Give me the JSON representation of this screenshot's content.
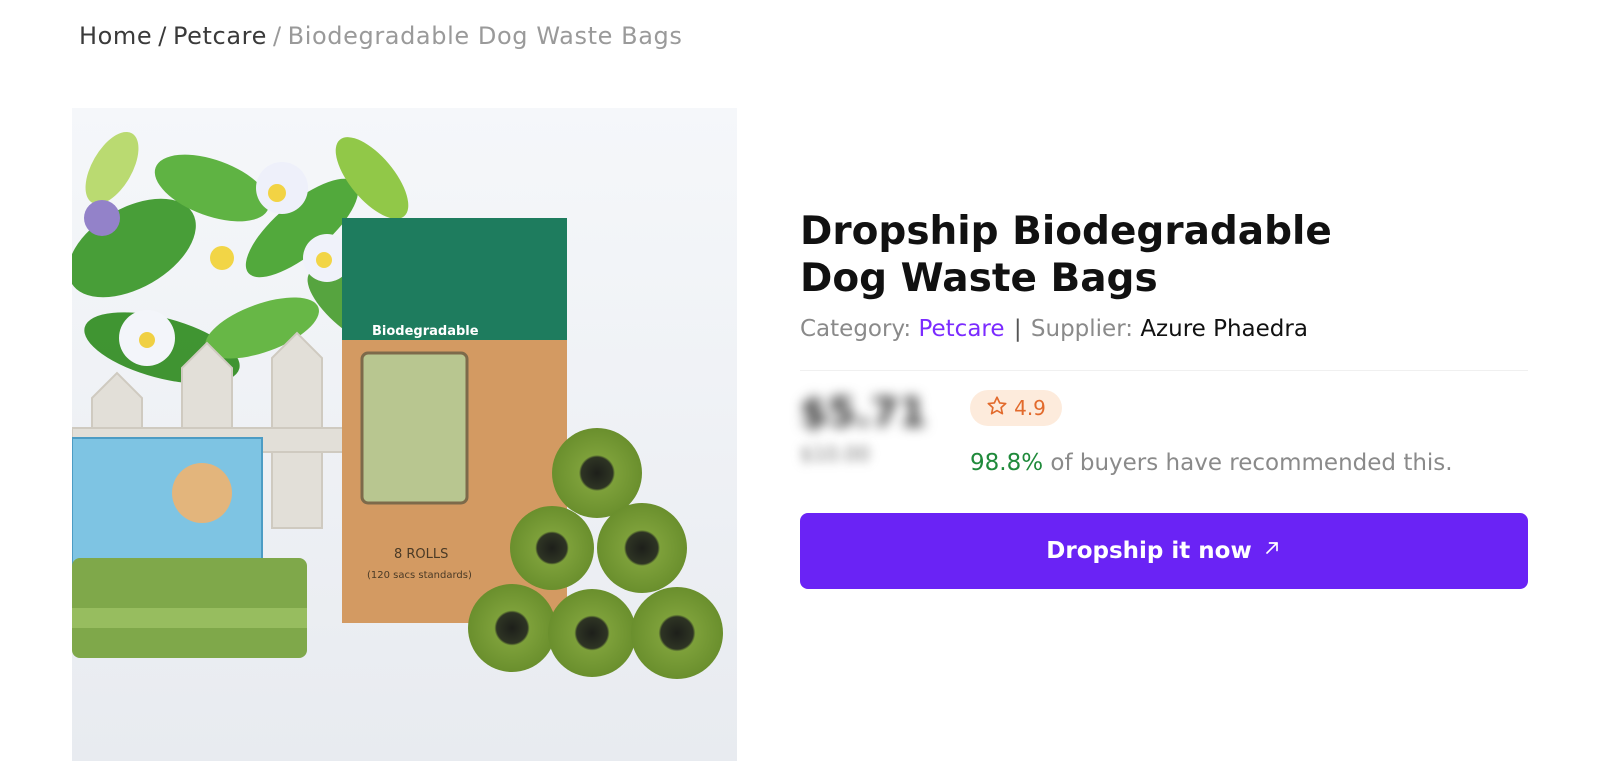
{
  "breadcrumb": {
    "home": "Home",
    "category": "Petcare",
    "current": "Biodegradable Dog Waste Bags",
    "separator": "/"
  },
  "product": {
    "title": "Dropship Biodegradable Dog Waste Bags",
    "category_label": "Category:",
    "category_value": "Petcare",
    "divider": "|",
    "supplier_label": "Supplier:",
    "supplier_value": "Azure Phaedra",
    "price_main": "$5.71",
    "price_old": "$10.00",
    "rating": "4.9",
    "rating_icon": "star-outline-icon",
    "recommend_pct": "98.8%",
    "recommend_text": "of buyers have recommended this.",
    "image_label_box": "Biodegradable",
    "image_label_rolls": "8 ROLLS",
    "image_label_sacs": "(120 sacs standards)"
  },
  "cta": {
    "label": "Dropship it now",
    "icon": "arrow-up-right-icon"
  },
  "colors": {
    "accent": "#6a23f5",
    "link": "#7b2bff",
    "rating": "#e26a2c",
    "rating_bg": "#fdebdc",
    "success": "#1f8a3b"
  }
}
